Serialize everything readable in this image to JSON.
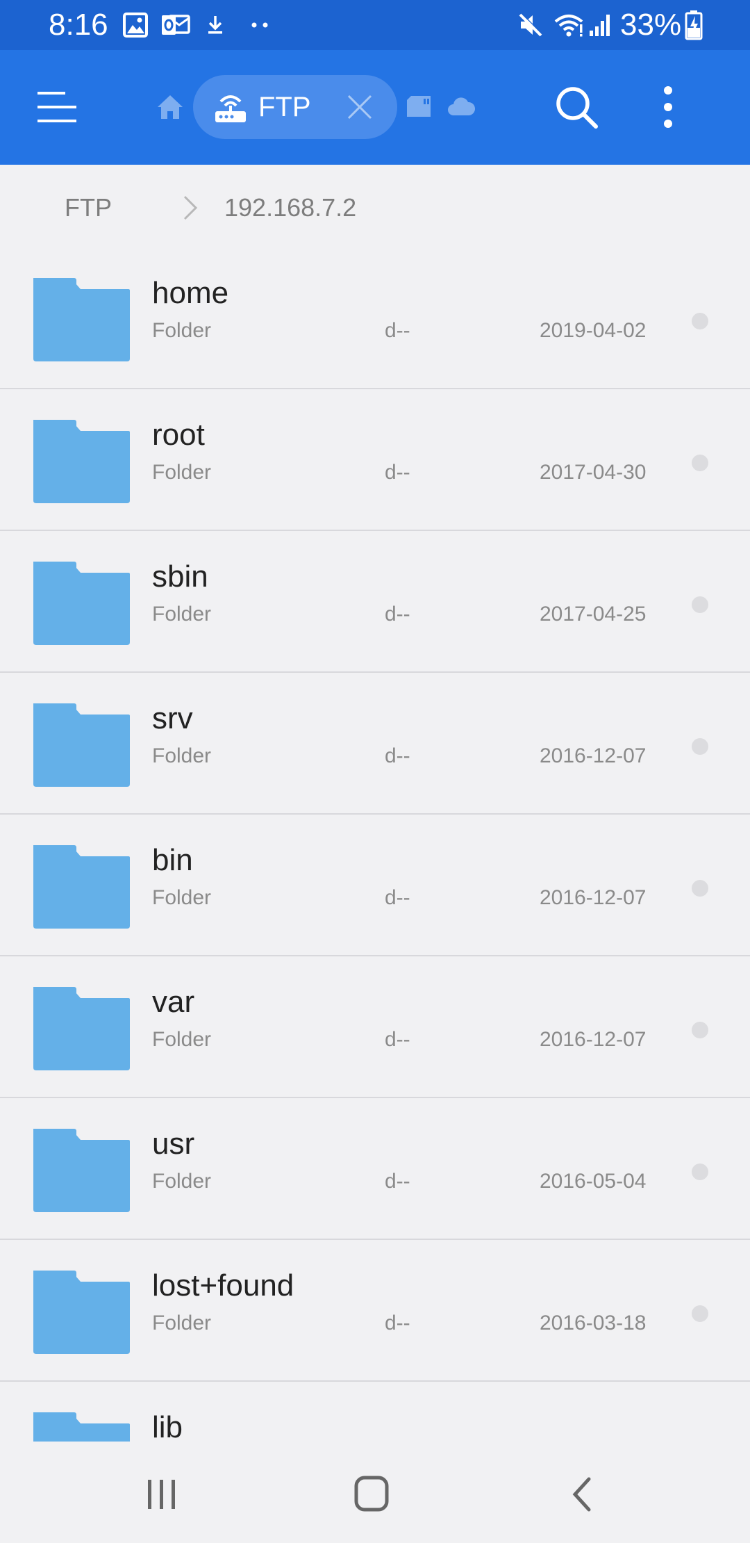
{
  "status_bar": {
    "time": "8:16",
    "battery_percent": "33%"
  },
  "app_bar": {
    "tab_label": "FTP",
    "colors": {
      "primary": "#2474e4",
      "status": "#1c63d0",
      "pill": "#4a8ceb"
    }
  },
  "breadcrumb": {
    "items": [
      "FTP",
      "192.168.7.2"
    ]
  },
  "files": [
    {
      "name": "home",
      "type": "Folder",
      "perm": "d--",
      "date": "2019-04-02"
    },
    {
      "name": "root",
      "type": "Folder",
      "perm": "d--",
      "date": "2017-04-30"
    },
    {
      "name": "sbin",
      "type": "Folder",
      "perm": "d--",
      "date": "2017-04-25"
    },
    {
      "name": "srv",
      "type": "Folder",
      "perm": "d--",
      "date": "2016-12-07"
    },
    {
      "name": "bin",
      "type": "Folder",
      "perm": "d--",
      "date": "2016-12-07"
    },
    {
      "name": "var",
      "type": "Folder",
      "perm": "d--",
      "date": "2016-12-07"
    },
    {
      "name": "usr",
      "type": "Folder",
      "perm": "d--",
      "date": "2016-05-04"
    },
    {
      "name": "lost+found",
      "type": "Folder",
      "perm": "d--",
      "date": "2016-03-18"
    },
    {
      "name": "lib",
      "type": "",
      "perm": "",
      "date": ""
    }
  ],
  "folder_color": "#64b0e8"
}
